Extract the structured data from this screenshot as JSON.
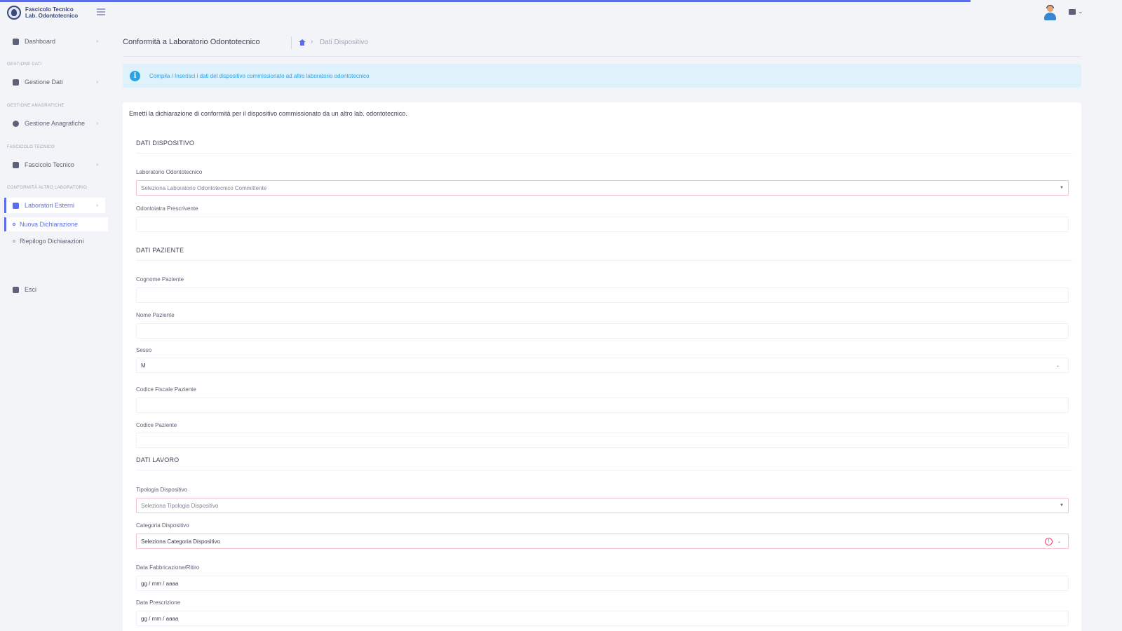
{
  "app": {
    "brand_line1": "Fascicolo Tecnico",
    "brand_line2": "Lab. Odontotecnico"
  },
  "sidebar": {
    "dashboard": "Dashboard",
    "section_dati": "Gestione Dati",
    "gestione_dati": "Gestione Dati",
    "section_anagrafiche": "Gestione Anagrafiche",
    "gestione_anagrafiche": "Gestione Anagrafiche",
    "section_fascicolo": "Fascicolo Tecnico",
    "fascicolo_tecnico": "Fascicolo Tecnico",
    "section_conformita": "Conformità altro laboratorio",
    "laboratori_esterni": "Laboratori Esterni",
    "nuova_dichiarazione": "Nuova Dichiarazione",
    "riepilogo_dichiarazioni": "Riepilogo Dichiarazioni",
    "esci": "Esci"
  },
  "header": {
    "page_title": "Conformità a Laboratorio Odontotecnico",
    "breadcrumb": "Dati Dispositivo"
  },
  "alert": {
    "text": "Compila / Inserisci i dati del dispositivo commissionato ad altro laboratorio odontotecnico"
  },
  "form": {
    "intro": "Emetti la dichiarazione di conformità per il dispositivo commissionato da un altro lab. odontotecnico.",
    "section_dispositivo": "DATI DISPOSITIVO",
    "lab_label": "Laboratorio Odontotecnico",
    "lab_placeholder": "Seleziona Laboratorio Odontotecnico Committente",
    "prescrittore_label": "Odontoiatra Prescrivente",
    "prescrittore_value": "",
    "section_paziente": "DATI PAZIENTE",
    "cognome_label": "Cognome Paziente",
    "cognome_value": "",
    "nome_label": "Nome Paziente",
    "nome_value": "",
    "sesso_label": "Sesso",
    "sesso_value": "M",
    "cf_label": "Codice Fiscale Paziente",
    "cf_value": "",
    "codice_label": "Codice Paziente",
    "codice_value": "",
    "section_lavoro": "DATI LAVORO",
    "tipologia_label": "Tipologia Dispositivo",
    "tipologia_placeholder": "Seleziona Tipologia Dispositivo",
    "categoria_label": "Categoria Dispositivo",
    "categoria_placeholder": "Seleziona Categoria Dispositivo",
    "data_label": "Data Fabbricazione/Ritiro",
    "data_placeholder": "gg / mm / aaaa",
    "prescrizione_label": "Data Prescrizione",
    "prescrizione_placeholder": "gg / mm / aaaa"
  }
}
